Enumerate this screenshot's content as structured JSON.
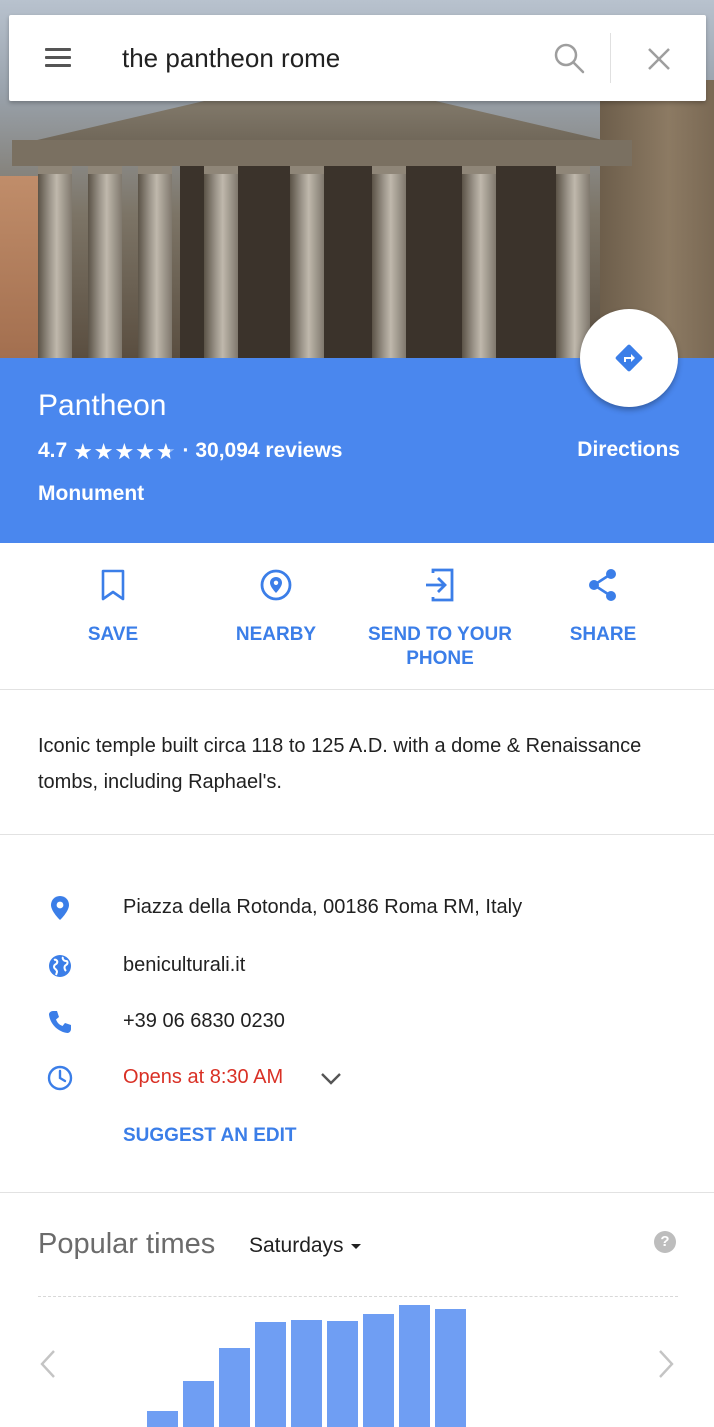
{
  "search": {
    "query": "the pantheon rome"
  },
  "place": {
    "name": "Pantheon",
    "rating": "4.7",
    "rating_fraction": 0.94,
    "stars_glyphs": "★★★★★",
    "reviews": "· 30,094 reviews",
    "category": "Monument",
    "directions_label": "Directions"
  },
  "actions": [
    {
      "label": "SAVE",
      "icon": "bookmark-icon"
    },
    {
      "label": "NEARBY",
      "icon": "nearby-icon"
    },
    {
      "label": "SEND TO YOUR PHONE",
      "icon": "send-to-phone-icon"
    },
    {
      "label": "SHARE",
      "icon": "share-icon"
    }
  ],
  "description": "Iconic temple built circa 118 to 125 A.D. with a dome & Renaissance tombs, including Raphael's.",
  "info": {
    "address": "Piazza della Rotonda, 00186 Roma RM, Italy",
    "website": "beniculturali.it",
    "phone": "+39 06 6830 0230",
    "hours": "Opens at 8:30 AM",
    "suggest_edit": "SUGGEST AN EDIT"
  },
  "popular_times": {
    "title": "Popular times",
    "day": "Saturdays",
    "help": "?",
    "bars": [
      0.12,
      0.35,
      0.6,
      0.8,
      0.82,
      0.81,
      0.86,
      0.93,
      0.9
    ]
  },
  "colors": {
    "header_blue": "#4a87ee",
    "action_blue": "#3b7ee8",
    "hours_red": "#d93025",
    "bar_blue": "#6f9ef3"
  }
}
